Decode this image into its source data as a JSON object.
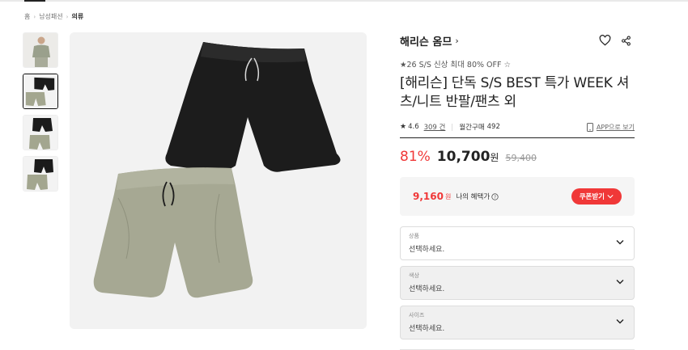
{
  "breadcrumb": [
    "홈",
    "남성패션",
    "의류"
  ],
  "brand": {
    "name": "해리슨 옴므"
  },
  "product": {
    "promo": "★26 S/S 신상 최대 80% OFF ☆",
    "title": "[해리슨] 단독 S/S BEST 특가 WEEK 셔츠/니트 반팔/팬츠 외",
    "rating": "4.6",
    "reviews": "309 건",
    "monthly_label": "월간구매",
    "monthly_count": "492",
    "app_link": "APP으로 보기"
  },
  "price": {
    "discount": "81%",
    "current": "10,700",
    "currency": "원",
    "original": "59,400"
  },
  "benefit": {
    "price": "9,160",
    "currency": "원",
    "label": "나의 혜택가",
    "coupon_button": "쿠폰받기"
  },
  "options": [
    {
      "label": "상품",
      "placeholder": "선택하세요."
    },
    {
      "label": "색상",
      "placeholder": "선택하세요."
    },
    {
      "label": "사이즈",
      "placeholder": "선택하세요."
    }
  ],
  "colors": {
    "accent": "#f03838",
    "text": "#222222"
  },
  "icons": [
    "chevron-right-icon",
    "heart-icon",
    "share-icon",
    "star-icon",
    "mobile-icon",
    "info-icon",
    "chevron-down-icon"
  ]
}
